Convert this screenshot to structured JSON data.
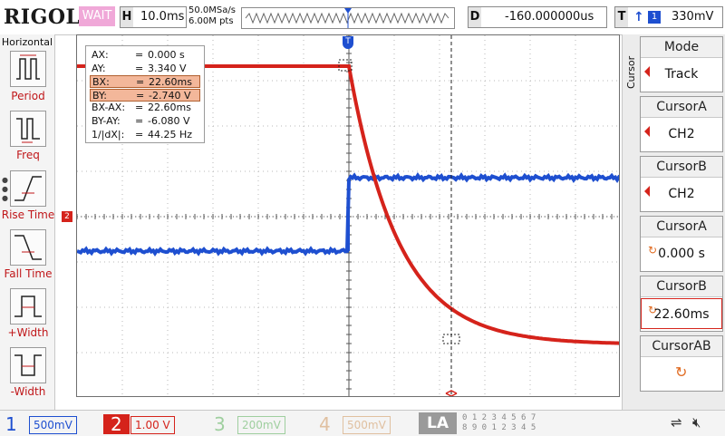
{
  "header": {
    "logo": "RIGOL",
    "run_state": "WAIT",
    "timebase_letter": "H",
    "timebase": "10.0ms",
    "sample_rate": "50.0MSa/s",
    "memory_depth": "6.00M pts",
    "delay_letter": "D",
    "delay": "-160.000000us",
    "trigger_letter": "T",
    "trigger_edge": "↑",
    "trigger_source": "1",
    "trigger_level": "330mV"
  },
  "left_panel": {
    "title": "Horizontal",
    "measurements": [
      "Period",
      "Freq",
      "Rise Time",
      "Fall Time",
      "+Width",
      "-Width"
    ]
  },
  "readout": {
    "rows": [
      {
        "key": "AX:",
        "eq": "=",
        "value": "0.000 s",
        "highlight": false
      },
      {
        "key": "AY:",
        "eq": "=",
        "value": "3.340 V",
        "highlight": false
      },
      {
        "key": "BX:",
        "eq": "=",
        "value": "22.60ms",
        "highlight": true
      },
      {
        "key": "BY:",
        "eq": "=",
        "value": "-2.740 V",
        "highlight": true
      },
      {
        "key": "BX-AX:",
        "eq": "=",
        "value": "22.60ms",
        "highlight": false
      },
      {
        "key": "BY-AY:",
        "eq": "=",
        "value": "-6.080 V",
        "highlight": false
      },
      {
        "key": "1/|dX|:",
        "eq": "=",
        "value": "44.25 Hz",
        "highlight": false
      }
    ]
  },
  "right_panel": {
    "side_label": "Cursor",
    "boxes": [
      {
        "title": "Mode",
        "value": "Track",
        "marker": "arrow"
      },
      {
        "title": "CursorA",
        "value": "CH2",
        "marker": "arrow"
      },
      {
        "title": "CursorB",
        "value": "CH2",
        "marker": "arrow"
      },
      {
        "title": "CursorA",
        "value": "0.000 s",
        "marker": "spin"
      },
      {
        "title": "CursorB",
        "value": "22.60ms",
        "marker": "spin"
      },
      {
        "title": "CursorAB",
        "value": "",
        "marker": "spin"
      }
    ]
  },
  "channels": [
    {
      "number": "1",
      "scale": "500mV",
      "color": "#1e4fd0",
      "active": true
    },
    {
      "number": "2",
      "scale": "1.00 V",
      "color": "#d5231b",
      "active": true
    },
    {
      "number": "3",
      "scale": "200mV",
      "color": "#9fcf9f",
      "active": false
    },
    {
      "number": "4",
      "scale": "500mV",
      "color": "#e0c0a0",
      "active": false
    }
  ],
  "logic": {
    "label": "LA",
    "bits_top": "0 1 2 3  4 5 6 7",
    "bits_bottom": "8 9 0 1  2 3 4 5"
  },
  "markers": {
    "ch2_ref": "2",
    "ch1_ref": "T",
    "trigger_pos": "T"
  },
  "colors": {
    "ch1": "#1e4fd0",
    "ch2": "#d5231b",
    "accent": "#d5231b"
  }
}
